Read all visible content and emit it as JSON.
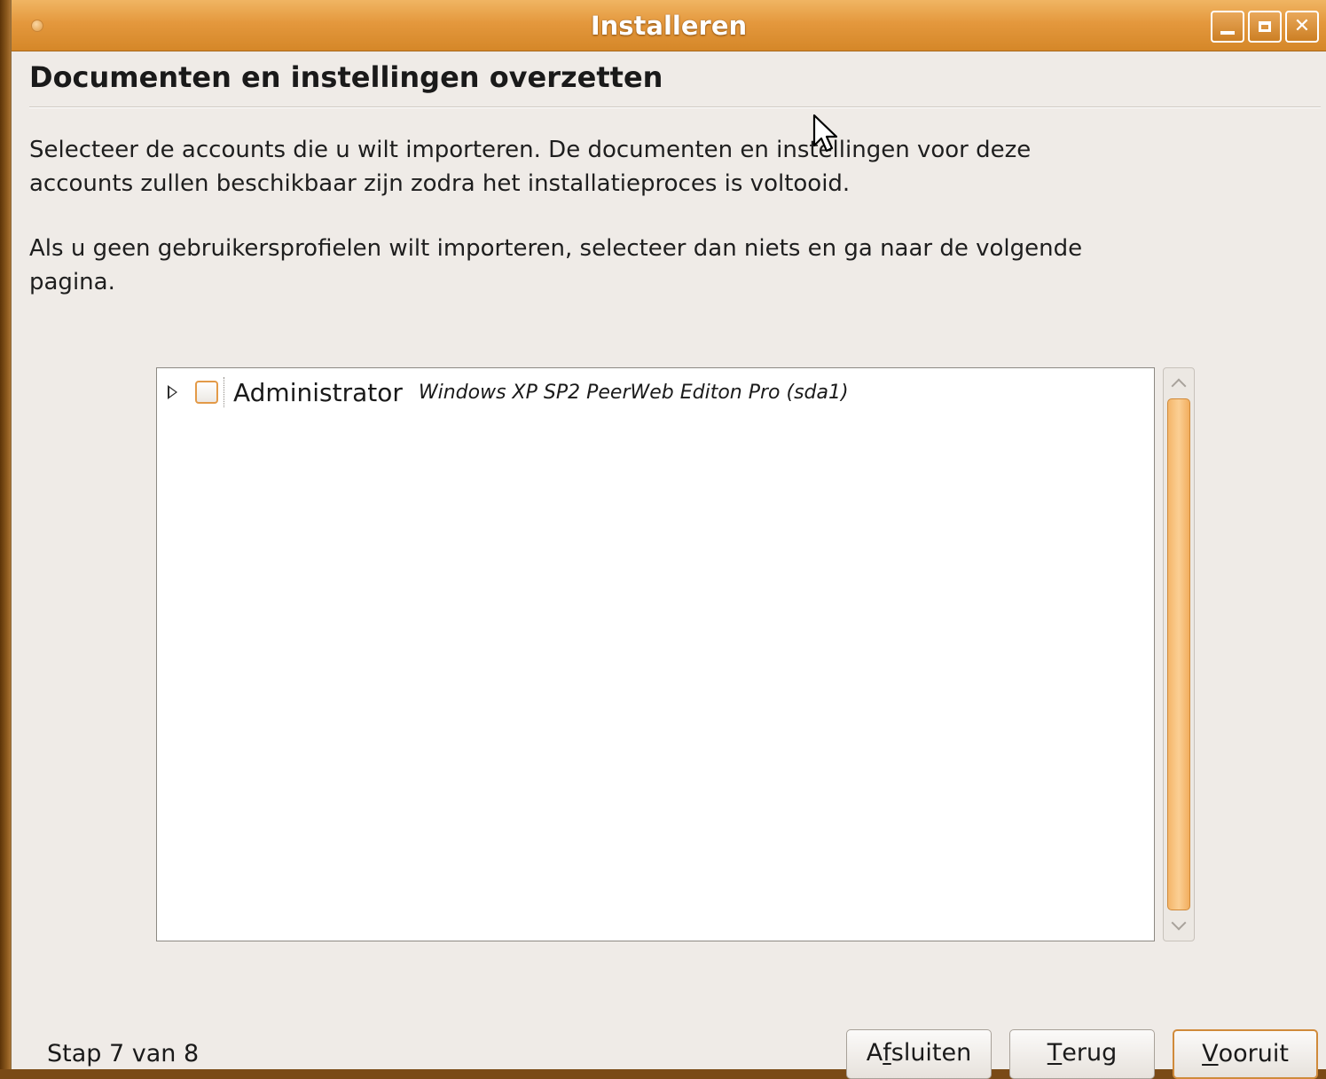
{
  "window": {
    "title": "Installeren",
    "controls": [
      "minimize",
      "maximize",
      "close"
    ]
  },
  "page": {
    "heading": "Documenten en instellingen overzetten",
    "para1_line1": "Selecteer de accounts die u wilt importeren. De documenten en instellingen voor deze",
    "para1_line2": "accounts zullen beschikbaar zijn zodra het installatieproces is voltooid.",
    "para2_line1": "Als u geen gebruikersprofielen wilt importeren, selecteer dan niets en ga naar de volgende",
    "para2_line2": "pagina."
  },
  "accounts": [
    {
      "name": "Administrator",
      "os": "Windows XP SP2 PeerWeb Editon Pro (sda1)",
      "checked": false,
      "expanded": false
    }
  ],
  "footer": {
    "step": "Stap 7 van 8",
    "quit_pre": "A",
    "quit_key": "f",
    "quit_post": "sluiten",
    "back_pre": "",
    "back_key": "T",
    "back_post": "erug",
    "next_pre": "",
    "next_key": "V",
    "next_post": "ooruit"
  },
  "colors": {
    "accent": "#e4983d",
    "background": "#efebe7"
  }
}
